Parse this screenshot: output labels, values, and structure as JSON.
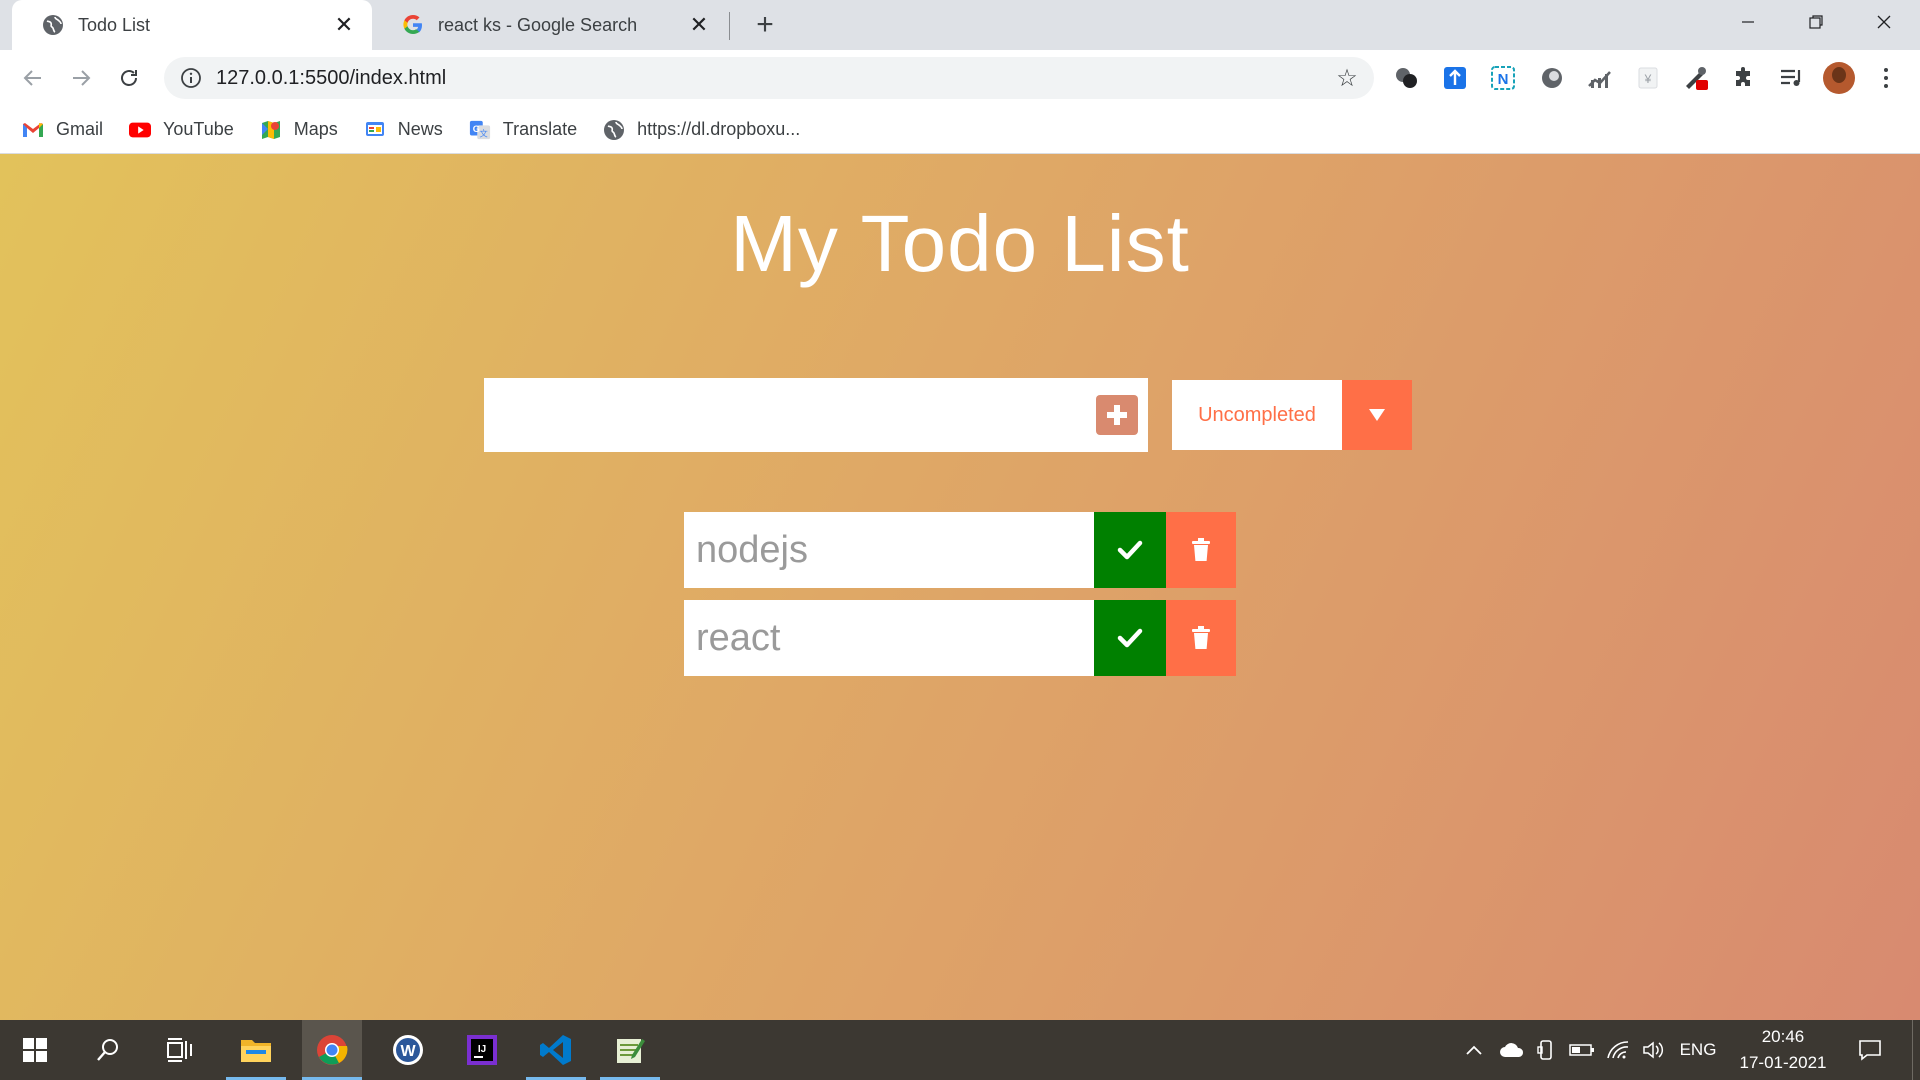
{
  "browser": {
    "tabs": [
      {
        "title": "Todo List",
        "active": true
      },
      {
        "title": "react ks - Google Search",
        "active": false
      }
    ],
    "url": "127.0.0.1:5500/index.html",
    "bookmarks": [
      {
        "label": "Gmail",
        "icon": "gmail-icon"
      },
      {
        "label": "YouTube",
        "icon": "youtube-icon"
      },
      {
        "label": "Maps",
        "icon": "maps-icon"
      },
      {
        "label": "News",
        "icon": "news-icon"
      },
      {
        "label": "Translate",
        "icon": "translate-icon"
      },
      {
        "label": "https://dl.dropboxu...",
        "icon": "globe-icon"
      }
    ]
  },
  "app": {
    "title": "My Todo List",
    "input": {
      "value": ""
    },
    "filter": {
      "selected": "Uncompleted"
    },
    "todos": [
      {
        "text": "nodejs"
      },
      {
        "text": "react"
      }
    ]
  },
  "taskbar": {
    "language": "ENG",
    "time": "20:46",
    "date": "17-01-2021"
  },
  "colors": {
    "accent": "#ff6f47",
    "complete": "#008000",
    "add_button": "#d98a6f"
  }
}
